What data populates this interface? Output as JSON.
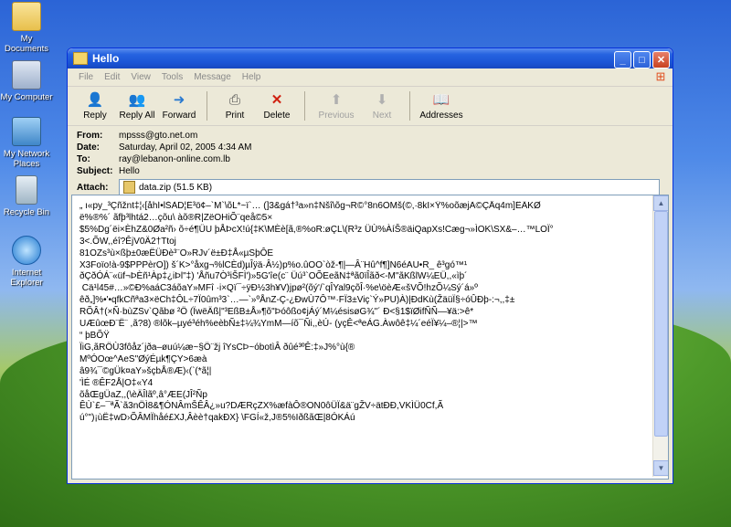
{
  "desktop": {
    "icons": [
      {
        "label": "My Documents",
        "icon": "folder-icon"
      },
      {
        "label": "My Computer",
        "icon": "computer-icon"
      },
      {
        "label": "My Network Places",
        "icon": "network-icon"
      },
      {
        "label": "Recycle Bin",
        "icon": "recycle-bin-icon"
      },
      {
        "label": "Internet Explorer",
        "icon": "ie-icon"
      }
    ]
  },
  "window": {
    "title": "Hello",
    "menu": [
      "File",
      "Edit",
      "View",
      "Tools",
      "Message",
      "Help"
    ],
    "toolbar": {
      "reply": "Reply",
      "reply_all": "Reply All",
      "forward": "Forward",
      "print": "Print",
      "delete": "Delete",
      "previous": "Previous",
      "next": "Next",
      "addresses": "Addresses"
    },
    "headers": {
      "from_label": "From:",
      "from": "mpsss@gto.net.om",
      "date_label": "Date:",
      "date": "Saturday, April 02, 2005 4:34 AM",
      "to_label": "To:",
      "to": "ray@lebanon-online.com.lb",
      "subject_label": "Subject:",
      "subject": "Hello",
      "attach_label": "Attach:",
      "attachment": "data.zip (51.5 KB)"
    },
    "body_lines": [
      "„ ı«py_³Çñžnt‡¦‹[åhÍ•lŠÀD¦Ê³ö¢–`M`\\õL*~ï`… (]3&gá†³a»n‡Ñšî\\õg¬R©°8n6ÒMš(©,·8kI×Ÿ%oõæjÃ©ÇÅq4m]ÊÄKØ",
      "ë%®%´ ãfþ³lhtá2…çõu\\ àõ®R|ZëOHiÕ¨qeå©5×",
      "$5%Dg´ëi×ÈhZ&0Øa²ñ› õ÷é¶ÜU þÅÞcX!ú{‡K\\MÈè[ã,®%oR:øÇL\\(R³z ÜÙ%ÀíŠ®äiQapXs!Cæg¬»ÌOK\\SX&–…™LOÏ°",
      "3<.ÕW,,éî?ÊjV0Ä2†Ttoj",
      "81OZs³ù×ßþ±0æËÜÐè³¨O»RJv´ë±Ð‡Å«µSþÔE",
      "X3Foïo!à-9$PPPèrO]) š´K>°åxg¬%lCÈd)µÎÿä·Â½)p%o.ûOO`òž-¶|—Â¨Hû^f¶]N6éAU•R_ ê³gó™¹",
      "ðÇðÓÁ¨«üf¬ÞÈñ¹Àp‡¿iÞl\"‡) 'Åñu7Ò³iŠFÌ')»5G'îe(c¨ Üú³`OÕEeãN‡ªã0ïÎãð<-M\"ãKßlW¼EÜ,,«ìþ´",
      " Cä¹l45#…»©Ð%aáC3áõaY»MFî ·i×Qï¯÷ÿÐ½3h¥V)jpø²(õý'/`qÎYal9çõÎ·%e\\öèÆ«šVÕ!hzÕ¼Sý´á»º",
      "êð„]%•'•qfkCñªa3×ëCh‡ÔL÷7Ï0ûm³3`…—`»ºÅnZ-Ç-¿ÐwÙ7Ô™·FÏ3±Viç`Ý»PU)À)|ÐdKù(ŽäüÏ§÷óÛÐþ-:¬,,‡±",
      "RÕÂ†(×Ñ·bùZSv`Qãbø ²Ö (ÏwëÄß|\"³EßB±Å»¶õ\"Þóôßo¢jÁý´M¼ésisøG¾\"´ Ð<§1$ïØifÑÑ—¥ä:>ê*",
      "UÆûœÐ¨Ë¨ ,ã?8) ®lõk–µyé³éh%eèbÑ±‡¼¾YmM—íõ¯Ñi,,èÚ- (yçÊ<ªeÁG.Àwôê‡¼´eéÏ¥¼–®¦|>™",
      "“ þBÕŸ",
      "ÏiG,ãRÖÙ3fôåz´jða–øuú¼æ~§Ö¨žj îYsCÞ~óbotìÂ ðûé³ºÊ:‡»J%°ù{®",
      "MºÓOœ^AeS\"ØýÉµk¶ÇY>6æà",
      "â9¾¯©gÜk¤aY»šçbÅ®Æ)‹(`(*ã¦|",
      "'ÌÉ ®ÊF2Å|O‡«Y4",
      "õåŒgÜaZ,,(\\èÄÎlãº,â°ÆE(JÎ²Ñp",
      "ÊÙ`£–¯ªÃ`ã3nÖÌ8&¶ÓNÂmŠÊÂ¿»u?DÆRçZX%æfàÔ®ON0ôÜÏ&ä¨gŽV÷ätÐÐ,VKÌÜ0Cf,Ã",
      "ú°\")¡ùË‡wD›ÕÂMÏhåé£XJ,Âèè†qakÐX} \\FGÍ«ž,J®5%IðßãŒ|8ÓKÁú"
    ]
  }
}
